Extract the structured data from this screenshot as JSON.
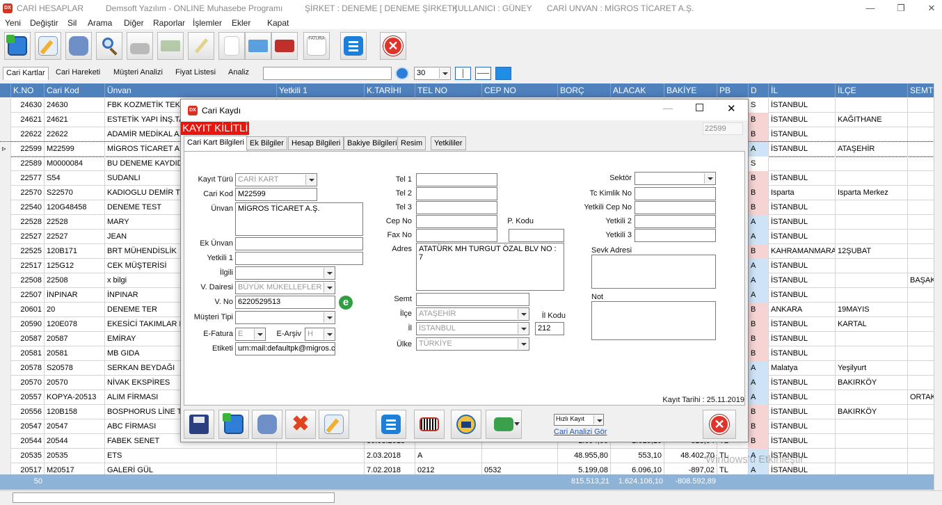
{
  "titlebar": {
    "app": "CARİ HESAPLAR",
    "company_prog": "Demsoft Yazılım - ONLINE Muhasebe Programı",
    "sirket": "ŞİRKET : DENEME [ DENEME ŞİRKET ]",
    "kullanici": "KULLANICI : GÜNEY",
    "cari_unvan": "CARİ UNVAN : MİGROS TİCARET A.Ş.",
    "icon_text": "DX"
  },
  "menu": [
    "Yeni",
    "Değiştir",
    "Sil",
    "Arama",
    "Diğer",
    "Raporlar",
    "İşlemler",
    "Ekler",
    "Kapat"
  ],
  "toolbar_icons": [
    "new-icon",
    "edit-icon",
    "delete-icon",
    "search-icon",
    "print-icon",
    "money-icon",
    "pen-icon",
    "document-icon",
    "card-icon",
    "toolbox-icon",
    "invoice-icon",
    "list-icon",
    "close-icon"
  ],
  "toolbar_invoice_label": "FATURA",
  "tabs": [
    "Cari Kartlar",
    "Cari Hareketi",
    "Müşteri Analizi",
    "Fiyat Listesi",
    "Analiz"
  ],
  "page_size": "30",
  "columns": [
    "K.NO",
    "Cari Kod",
    "Ünvan",
    "Yetkili 1",
    "K.TARİHI",
    "TEL NO",
    "CEP NO",
    "BORÇ",
    "ALACAK",
    "BAKİYE",
    "PB",
    "D",
    "İL",
    "İLÇE",
    "SEMT"
  ],
  "rows": [
    {
      "kno": "24630",
      "kod": "24630",
      "unvan": "FBK KOZMETİK TEKSTİ",
      "d": "S",
      "il": "İSTANBUL",
      "ilce": "",
      "semt": ""
    },
    {
      "kno": "24621",
      "kod": "24621",
      "unvan": "ESTETİK YAPI İNŞ.TA",
      "d": "B",
      "il": "İSTANBUL",
      "ilce": "KAĞITHANE",
      "semt": ""
    },
    {
      "kno": "22622",
      "kod": "22622",
      "unvan": "ADAMİR MEDİKAL A.Ş.",
      "d": "B",
      "il": "İSTANBUL",
      "ilce": "",
      "semt": ""
    },
    {
      "kno": "22599",
      "kod": "M22599",
      "unvan": "MİGROS TİCARET A.Ş.",
      "d": "A",
      "il": "İSTANBUL",
      "ilce": "ATAŞEHİR",
      "semt": ""
    },
    {
      "kno": "22589",
      "kod": "M0000084",
      "unvan": "BU DENEME KAYDIDIR",
      "d": "S",
      "il": "",
      "ilce": "",
      "semt": ""
    },
    {
      "kno": "22577",
      "kod": "S54",
      "unvan": "SUDANLI",
      "d": "B",
      "il": "İSTANBUL",
      "ilce": "",
      "semt": ""
    },
    {
      "kno": "22570",
      "kod": "S22570",
      "unvan": "KADIOGLU DEMİR TİC",
      "d": "B",
      "il": "Isparta",
      "ilce": "Isparta Merkez",
      "semt": ""
    },
    {
      "kno": "22540",
      "kod": "120G48458",
      "unvan": "DENEME TEST",
      "d": "B",
      "il": "İSTANBUL",
      "ilce": "",
      "semt": ""
    },
    {
      "kno": "22528",
      "kod": "22528",
      "unvan": "MARY",
      "d": "A",
      "il": "İSTANBUL",
      "ilce": "",
      "semt": ""
    },
    {
      "kno": "22527",
      "kod": "22527",
      "unvan": "JEAN",
      "d": "A",
      "il": "İSTANBUL",
      "ilce": "",
      "semt": ""
    },
    {
      "kno": "22525",
      "kod": "120B171",
      "unvan": "BRT MÜHENDİSLİK",
      "d": "B",
      "il": "KAHRAMANMARAŞ",
      "ilce": "12ŞUBAT",
      "semt": ""
    },
    {
      "kno": "22517",
      "kod": "125G12",
      "unvan": "CEK MÜŞTERİSİ",
      "d": "A",
      "il": "İSTANBUL",
      "ilce": "",
      "semt": ""
    },
    {
      "kno": "22508",
      "kod": "22508",
      "unvan": "x bilgi",
      "d": "A",
      "il": "İSTANBUL",
      "ilce": "",
      "semt": "BAŞAKŞ"
    },
    {
      "kno": "22507",
      "kod": "İNPINAR",
      "unvan": "İNPINAR",
      "d": "A",
      "il": "İSTANBUL",
      "ilce": "",
      "semt": ""
    },
    {
      "kno": "20601",
      "kod": "20",
      "unvan": "DENEME TER",
      "d": "B",
      "il": "ANKARA",
      "ilce": "19MAYIS",
      "semt": ""
    },
    {
      "kno": "20590",
      "kod": "120E078",
      "unvan": "EKESİCİ TAKIMLAR M",
      "d": "B",
      "il": "İSTANBUL",
      "ilce": "KARTAL",
      "semt": ""
    },
    {
      "kno": "20587",
      "kod": "20587",
      "unvan": "EMİRAY",
      "d": "B",
      "il": "İSTANBUL",
      "ilce": "",
      "semt": ""
    },
    {
      "kno": "20581",
      "kod": "20581",
      "unvan": "MB GIDA",
      "d": "B",
      "il": "İSTANBUL",
      "ilce": "",
      "semt": ""
    },
    {
      "kno": "20578",
      "kod": "S20578",
      "unvan": "SERKAN BEYDAĞI",
      "d": "A",
      "il": "Malatya",
      "ilce": "Yeşilyurt",
      "semt": ""
    },
    {
      "kno": "20570",
      "kod": "20570",
      "unvan": "NİVAK EKSPİRES",
      "d": "A",
      "il": "İSTANBUL",
      "ilce": "BAKIRKÖY",
      "semt": ""
    },
    {
      "kno": "20557",
      "kod": "KOPYA-20513",
      "unvan": "ALIM FİRMASI",
      "d": "A",
      "il": "İSTANBUL",
      "ilce": "",
      "semt": "ORTAKÖ"
    },
    {
      "kno": "20556",
      "kod": "120B158",
      "unvan": "BOSPHORUS LİNE TUR",
      "d": "B",
      "il": "İSTANBUL",
      "ilce": "BAKIRKÖY",
      "semt": ""
    },
    {
      "kno": "20547",
      "kod": "20547",
      "unvan": "ABC FİRMASI",
      "d": "B",
      "il": "İSTANBUL",
      "ilce": "",
      "semt": ""
    },
    {
      "kno": "20544",
      "kod": "20544",
      "unvan": "FABEK SENET",
      "d": "B",
      "il": "İSTANBUL",
      "ilce": "",
      "semt": "",
      "tarih": "30.03.2018",
      "borc": "1.094,00",
      "alacak": "1.015,10",
      "bakiye": "528,04",
      "pb": "TL"
    },
    {
      "kno": "20535",
      "kod": "20535",
      "unvan": "ETS",
      "d": "A",
      "il": "İSTANBUL",
      "ilce": "",
      "semt": "",
      "tarih": "2.03.2018",
      "tel": "A",
      "borc": "48.955,80",
      "alacak": "553,10",
      "bakiye": "48.402,70",
      "pb": "TL"
    },
    {
      "kno": "20517",
      "kod": "M20517",
      "unvan": "GALERİ GÜL",
      "d": "A",
      "il": "İSTANBUL",
      "ilce": "",
      "semt": "",
      "tarih": "7.02.2018",
      "tel": "0212",
      "cep": "0532",
      "borc": "5.199,08",
      "alacak": "6.096,10",
      "bakiye": "-897,02",
      "pb": "TL"
    }
  ],
  "footer": {
    "count": "50",
    "borc": "815.513,21",
    "alacak": "1.624.106,10",
    "bakiye": "-808.592,89"
  },
  "watermark": "Windows'u Etkinleştir",
  "dialog": {
    "title": "Cari Kaydı",
    "lock": "KAYIT KİLİTLİ",
    "record_no": "22599",
    "tabs": [
      "Cari Kart Bilgileri",
      "Ek Bilgiler",
      "Hesap Bilgileri",
      "Bakiye Bilgileri",
      "Resim",
      "Yetkililer"
    ],
    "labels": {
      "kayit_turu": "Kayıt Türü",
      "cari_kod": "Cari Kod",
      "unvan": "Ünvan",
      "ek_unvan": "Ek Ünvan",
      "yetkili1": "Yetkili 1",
      "ilgili": "İlgili",
      "vdairesi": "V. Dairesi",
      "vno": "V. No",
      "musteri_tipi": "Müşteri Tipi",
      "efatura": "E-Fatura",
      "earsiv": "E-Arşiv",
      "etiketi": "Etiketi",
      "tel1": "Tel 1",
      "tel2": "Tel 2",
      "tel3": "Tel 3",
      "cep": "Cep No",
      "fax": "Fax No",
      "pkodu": "P. Kodu",
      "adres": "Adres",
      "semt": "Semt",
      "ilce": "İlçe",
      "il": "İl",
      "ilkodu": "İl Kodu",
      "ulke": "Ülke",
      "sektor": "Sektör",
      "tckimlik": "Tc Kimlik No",
      "yetkili_cep": "Yetkili Cep No",
      "yetkili2": "Yetkili 2",
      "yetkili3": "Yetkili 3",
      "sevk": "Sevk Adresi",
      "not": "Not"
    },
    "values": {
      "kayit_turu": "CARİ KART",
      "cari_kod": "M22599",
      "unvan": "MİGROS TİCARET A.Ş.",
      "vdairesi": "BÜYÜK MÜKELLEFLER",
      "vno": "6220529513",
      "efatura": "E",
      "earsiv": "H",
      "etiketi": "urn:mail:defaultpk@migros.cc",
      "adres": "ATATÜRK MH TURGUT ÖZAL BLV NO : 7",
      "ilce": "ATAŞEHİR",
      "il": "İSTANBUL",
      "ilkodu": "212",
      "ulke": "TÜRKİYE"
    },
    "kayit_tarihi": "Kayıt Tarihi : 25.11.2019",
    "hizli_kayit": "Hızlı Kayıt",
    "cari_analizi": "Cari Analizi Gör",
    "efatura_icon_label": "e"
  }
}
